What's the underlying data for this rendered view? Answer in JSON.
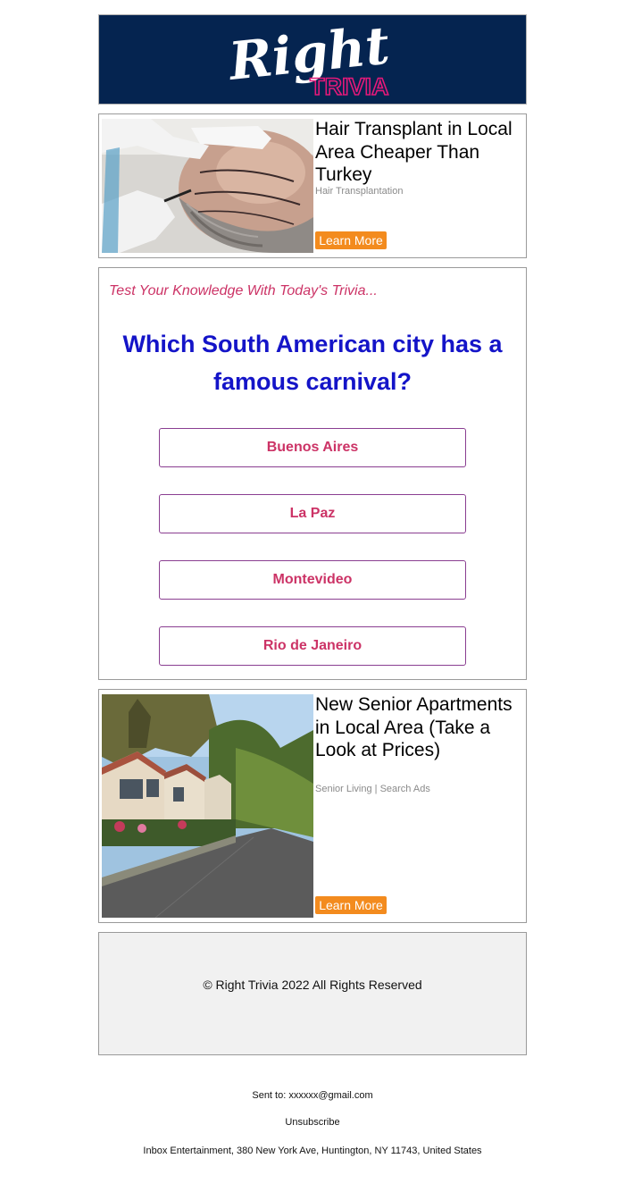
{
  "header": {
    "logo_word": "Right",
    "logo_sub": "TRIVIA"
  },
  "ads": [
    {
      "title": "Hair Transplant in Local Area Cheaper Than Turkey",
      "source": "Hair Transplantation",
      "cta": "Learn More",
      "image": "hair-transplant-photo"
    },
    {
      "title": "New Senior Apartments in Local Area (Take a Look at Prices)",
      "source": "Senior Living | Search Ads",
      "cta": "Learn More",
      "image": "senior-apartments-street-photo"
    }
  ],
  "trivia": {
    "intro": "Test Your Knowledge With Today's Trivia...",
    "question": "Which South American city has a famous carnival?",
    "answers": [
      "Buenos Aires",
      "La Paz",
      "Montevideo",
      "Rio de Janeiro"
    ]
  },
  "footer": {
    "copyright": "© Right Trivia 2022 All Rights Reserved",
    "sent_to": "Sent to: xxxxxx@gmail.com",
    "unsubscribe": "Unsubscribe",
    "address": "Inbox Entertainment, 380 New York Ave, Huntington, NY 11743, United States"
  },
  "colors": {
    "header_bg": "#052450",
    "logo_accent": "#e5197a",
    "cta_bg": "#f38b1e",
    "question": "#1414c8",
    "answer_text": "#cc3366",
    "answer_border": "#8a3e91"
  }
}
